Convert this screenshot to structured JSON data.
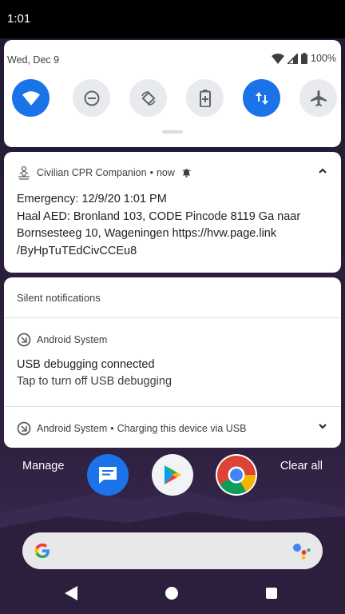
{
  "status_bar": {
    "time": "1:01"
  },
  "quick_settings": {
    "date": "Wed, Dec 9",
    "battery": "100%",
    "tiles": [
      {
        "name": "wifi",
        "state": "on"
      },
      {
        "name": "do-not-disturb",
        "state": "off"
      },
      {
        "name": "auto-rotate",
        "state": "off"
      },
      {
        "name": "battery-saver",
        "state": "off"
      },
      {
        "name": "mobile-data",
        "state": "on"
      },
      {
        "name": "airplane-mode",
        "state": "off"
      }
    ]
  },
  "notifications": {
    "cpr": {
      "app": "Civilian CPR Companion",
      "separator": "•",
      "time": "now",
      "lines": [
        "Emergency: 12/9/20 1:01 PM",
        "Haal AED: Bronland 103, CODE Pincode 8119 Ga naar",
        "Bornsesteeg 10, Wageningen https://hvw.page.link",
        "/ByHpTuTEdCivCCEu8"
      ]
    },
    "silent": {
      "title": "Silent notifications",
      "usb": {
        "app": "Android System",
        "title": "USB debugging connected",
        "text": "Tap to turn off USB debugging"
      },
      "charging": {
        "app": "Android System",
        "separator": "•",
        "text": "Charging this device via USB"
      }
    }
  },
  "actions": {
    "manage": "Manage",
    "clear_all": "Clear all"
  },
  "colors": {
    "accent": "#1a73e8"
  }
}
